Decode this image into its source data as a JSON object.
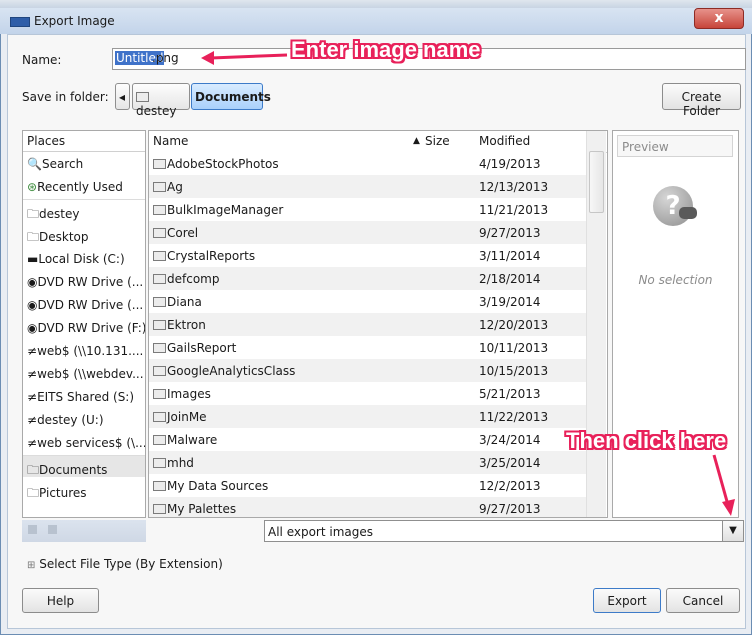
{
  "dialog": {
    "title": "Export Image",
    "close_glyph": "x"
  },
  "name_row": {
    "label": "Name:",
    "selected_part": "Untitled",
    "rest": ".png"
  },
  "folder_row": {
    "label": "Save in folder:",
    "back_glyph": "◂",
    "crumbs": [
      "destey",
      "Documents"
    ],
    "create_label": "Create Folder"
  },
  "places": {
    "header": "Places",
    "items": [
      {
        "label": "Search",
        "icon": "search-icon"
      },
      {
        "label": "Recently Used",
        "icon": "recent-icon"
      },
      {
        "label": "destey",
        "icon": "folder-icon"
      },
      {
        "label": "Desktop",
        "icon": "folder-icon"
      },
      {
        "label": "Local Disk (C:)",
        "icon": "drive-icon"
      },
      {
        "label": "DVD RW Drive (...",
        "icon": "dvd-icon"
      },
      {
        "label": "DVD RW Drive (...",
        "icon": "dvd-icon"
      },
      {
        "label": "DVD RW Drive (F:)",
        "icon": "dvd-icon"
      },
      {
        "label": "web$ (\\\\10.131....",
        "icon": "network-icon"
      },
      {
        "label": "web$ (\\\\webdev...",
        "icon": "network-icon"
      },
      {
        "label": "EITS Shared (S:)",
        "icon": "network-icon"
      },
      {
        "label": "destey (U:)",
        "icon": "network-icon"
      },
      {
        "label": "web services$ (\\...",
        "icon": "network-icon"
      },
      {
        "label": "Documents",
        "icon": "folder-icon"
      },
      {
        "label": "Pictures",
        "icon": "folder-icon"
      }
    ]
  },
  "files": {
    "columns": {
      "name": "Name",
      "size": "Size",
      "modified": "Modified",
      "sort_glyph": "▲"
    },
    "rows": [
      {
        "name": "AdobeStockPhotos",
        "modified": "4/19/2013"
      },
      {
        "name": "Ag",
        "modified": "12/13/2013"
      },
      {
        "name": "BulkImageManager",
        "modified": "11/21/2013"
      },
      {
        "name": "Corel",
        "modified": "9/27/2013"
      },
      {
        "name": "CrystalReports",
        "modified": "3/11/2014"
      },
      {
        "name": "defcomp",
        "modified": "2/18/2014"
      },
      {
        "name": "Diana",
        "modified": "3/19/2014"
      },
      {
        "name": "Ektron",
        "modified": "12/20/2013"
      },
      {
        "name": "GailsReport",
        "modified": "10/11/2013"
      },
      {
        "name": "GoogleAnalyticsClass",
        "modified": "10/15/2013"
      },
      {
        "name": "Images",
        "modified": "5/21/2013"
      },
      {
        "name": "JoinMe",
        "modified": "11/22/2013"
      },
      {
        "name": "Malware",
        "modified": "3/24/2014"
      },
      {
        "name": "mhd",
        "modified": "3/25/2014"
      },
      {
        "name": "My Data Sources",
        "modified": "12/2/2013"
      },
      {
        "name": "My Palettes",
        "modified": "9/27/2013"
      }
    ]
  },
  "preview": {
    "header": "Preview",
    "empty_text": "No selection"
  },
  "filter": {
    "value": "All export images"
  },
  "file_type": {
    "label": "Select File Type (By Extension)",
    "expander": "⊞"
  },
  "buttons": {
    "help": "Help",
    "export": "Export",
    "cancel": "Cancel"
  },
  "annotations": {
    "enter_name": "Enter image name",
    "click_here": "Then click here",
    "color": "#e8215a"
  }
}
